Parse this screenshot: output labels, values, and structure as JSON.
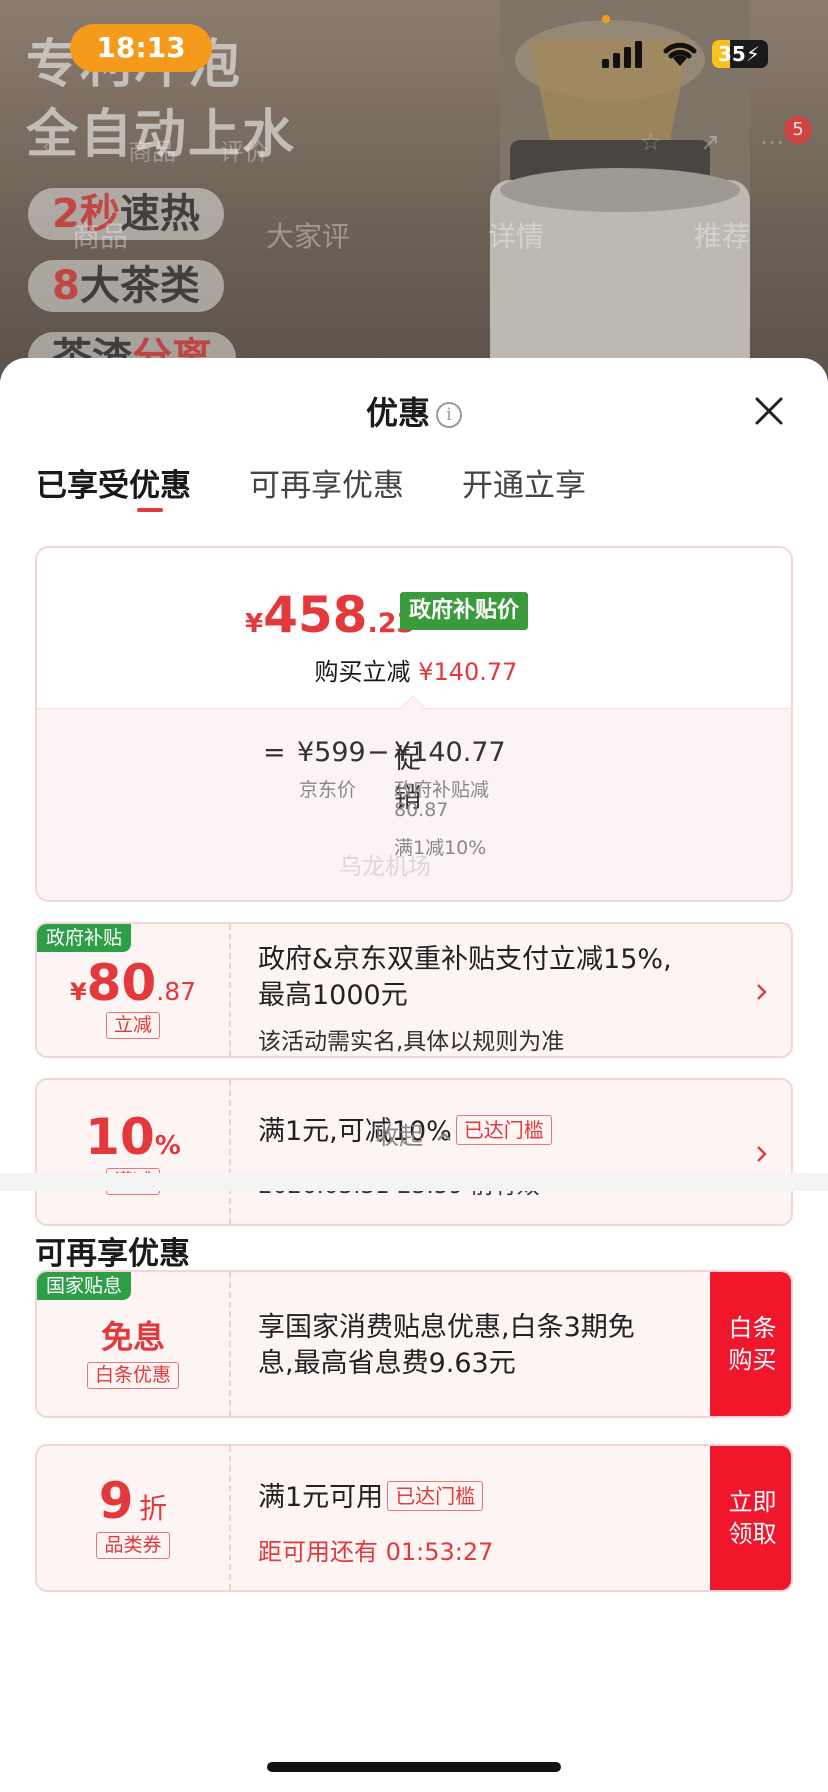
{
  "status_bar": {
    "time": "18:13",
    "battery": "35"
  },
  "background": {
    "promo_lines": [
      "专利冲泡",
      "全自动上水"
    ],
    "pills": [
      {
        "highlight": "2秒",
        "text": "速热"
      },
      {
        "highlight": "8",
        "text": "大茶类"
      },
      {
        "text": "茶渣",
        "highlight": "分离"
      }
    ],
    "tabs": [
      "商品",
      "大家评",
      "详情",
      "推荐"
    ],
    "nav_segments": [
      "商品",
      "评价"
    ],
    "badge": "5"
  },
  "sheet": {
    "title": "优惠",
    "tabs": [
      "已享受优惠",
      "可再享优惠",
      "开通立享"
    ],
    "price_card": {
      "currency": "¥",
      "price_int": "458",
      "price_dec": ".23",
      "tag": "政府补贴价",
      "cut_label": "购买立减",
      "cut_amount": "¥140.77",
      "equals": "=",
      "jd_price": "¥599",
      "minus": "−",
      "promo_label": "促销",
      "promo_amount": "¥140.77",
      "jd_price_label": "京东价",
      "sub1_label": "政府补贴减",
      "sub1_value": "80.87",
      "sub2": "满1减10%",
      "watermark": "乌龙机场"
    },
    "coupons": [
      {
        "corner_tag": "政府补贴",
        "currency": "¥",
        "amount_int": "80",
        "amount_dec": ".87",
        "type": "立减",
        "line1": "政府&京东双重补贴支付立减15%,",
        "line2": "最高1000元",
        "note": "该活动需实名,具体以规则为准"
      },
      {
        "amount": "10",
        "unit": "%",
        "type": "满减",
        "line1": "满1元,可减10%",
        "badge": "已达门槛",
        "note": "2026.03.31 23:59 前有效"
      }
    ],
    "collapse_label": "收起",
    "more_title": "可再享优惠",
    "more_coupons": [
      {
        "corner_tag": "国家贴息",
        "amount": "免息",
        "type": "白条优惠",
        "line1": "享国家消费贴息优惠,白条3期免",
        "line2": "息,最高省息费9.63元",
        "action": "白条购买"
      },
      {
        "amount": "9",
        "unit": "折",
        "type": "品类券",
        "line1": "满1元可用",
        "badge": "已达门槛",
        "countdown": "距可用还有 01:53:27",
        "action": "立即领取"
      }
    ]
  },
  "colors": {
    "accent": "#e4393c",
    "gov_green": "#3a9b3c",
    "action_red": "#f0172c"
  }
}
